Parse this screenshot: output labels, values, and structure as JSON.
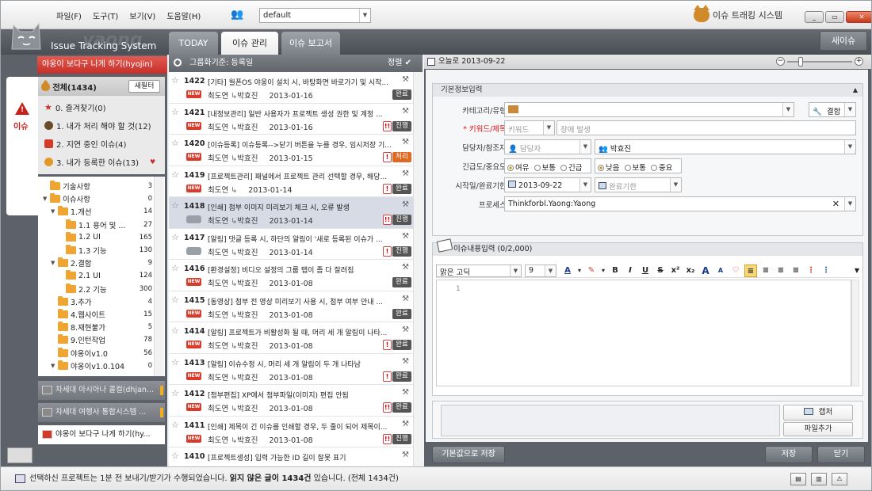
{
  "menu": [
    "파일(F)",
    "도구(T)",
    "보기(V)",
    "도움말(H)"
  ],
  "profile": {
    "value": "default"
  },
  "brand": "이슈 트래킹 시스템",
  "window_buttons": [
    "_",
    "▭",
    "✕"
  ],
  "logo": {
    "text": "Issue Tracking System",
    "watermark": "yaong"
  },
  "tabs": [
    "TODAY",
    "이슈 관리",
    "이슈 보고서"
  ],
  "new_issue": "새이슈",
  "left": {
    "project_header": "야옹이 보다구 나게 하기(hyojin)",
    "side_tab": "이슈",
    "all": "전체(1434)",
    "new_filter": "새필터",
    "filters": [
      "0. 즐겨찾기(0)",
      "1. 내가 처리 해야 할 것(12)",
      "2. 지연 중인 이슈(4)",
      "3. 내가 등록한 이슈(13)"
    ],
    "tree": [
      {
        "label": "기술사항",
        "count": "3",
        "level": 0,
        "toggle": ""
      },
      {
        "label": "이슈사항",
        "count": "0",
        "level": 0,
        "toggle": "▼"
      },
      {
        "label": "1.개선",
        "count": "14",
        "level": 1,
        "toggle": "▼"
      },
      {
        "label": "1.1 용어 및 ...",
        "count": "27",
        "level": 2,
        "toggle": ""
      },
      {
        "label": "1.2 UI",
        "count": "165",
        "level": 2,
        "toggle": ""
      },
      {
        "label": "1.3 기능",
        "count": "130",
        "level": 2,
        "toggle": ""
      },
      {
        "label": "2.결함",
        "count": "9",
        "level": 1,
        "toggle": "▼"
      },
      {
        "label": "2.1 UI",
        "count": "124",
        "level": 2,
        "toggle": ""
      },
      {
        "label": "2.2 기능",
        "count": "300",
        "level": 2,
        "toggle": ""
      },
      {
        "label": "3.추가",
        "count": "4",
        "level": 1,
        "toggle": ""
      },
      {
        "label": "4.웹사이트",
        "count": "15",
        "level": 1,
        "toggle": ""
      },
      {
        "label": "8.재현불가",
        "count": "5",
        "level": 1,
        "toggle": ""
      },
      {
        "label": "9.인턴작업",
        "count": "78",
        "level": 1,
        "toggle": ""
      },
      {
        "label": "야옹이v1.0",
        "count": "56",
        "level": 1,
        "toggle": ""
      },
      {
        "label": "야옹이v1.0.104",
        "count": "0",
        "level": 1,
        "toggle": "▼"
      }
    ],
    "projects": [
      "차세대 아시아나 콜컬(dhjan...",
      "차세대 여행사 통합시스템 ...",
      "야옹이 보다구 나게 하기(hy..."
    ]
  },
  "middle": {
    "group_by": "그룹화기준: 등록일",
    "sort": "정렬 ✔",
    "issues": [
      {
        "num": "1422",
        "title": "[기타] 월폰OS 야옹이 설치 시, 바탕화면 바로가기 및 시작...",
        "author": "최도연",
        "assignee": "박효진",
        "date": "2013-01-16",
        "status": "완료",
        "pri": "",
        "icon": "NEW"
      },
      {
        "num": "1421",
        "title": "[내정보관리] 일반 사용자가 프로젝트 생성 권한 및 계정 ...",
        "author": "최도연",
        "assignee": "박효진",
        "date": "2013-01-16",
        "status": "진행",
        "pri": "!!",
        "icon": "NEW"
      },
      {
        "num": "1420",
        "title": "[이슈등록] 이슈등록-->닫기 버튼을 누를 경우, 임시저장 기...",
        "author": "최도연",
        "assignee": "박효진",
        "date": "2013-01-15",
        "status": "처리",
        "pri": "!",
        "icon": "NEW"
      },
      {
        "num": "1419",
        "title": "[프로젝트관리] 패널에서 프로젝트 관리 선택할 경우, 해당...",
        "author": "최도연",
        "assignee": "",
        "date": "2013-01-14",
        "status": "완료",
        "pri": "!",
        "icon": "NEW"
      },
      {
        "num": "1418",
        "title": "[인쇄] 첨부 이미지 미리보기 체크 시, 오류 발생",
        "author": "최도연",
        "assignee": "박효진",
        "date": "2013-01-14",
        "status": "진행",
        "pri": "!!",
        "icon": "bubble"
      },
      {
        "num": "1417",
        "title": "[알림] 댓글 등록 시, 하단의 알림이 '새로 등록된 이슈가 ...",
        "author": "최도연",
        "assignee": "박효진",
        "date": "2013-01-14",
        "status": "진행",
        "pri": "!",
        "icon": "bubble"
      },
      {
        "num": "1416",
        "title": "[환경설정] 비디오 설정의 그룹 탭이 좀 다 잘려짐",
        "author": "최도연",
        "assignee": "박효진",
        "date": "2013-01-08",
        "status": "완료",
        "pri": "",
        "icon": "NEW"
      },
      {
        "num": "1415",
        "title": "[동영상] 첨부 전 영상 미리보기 사용 시, 첨부 여부 안내 ...",
        "author": "최도연",
        "assignee": "박효진",
        "date": "2013-01-08",
        "status": "완료",
        "pri": "",
        "icon": "NEW"
      },
      {
        "num": "1414",
        "title": "[알림] 프로젝트가 비활성화 될 때, 머리 세 개 알림이 나타...",
        "author": "최도연",
        "assignee": "박효진",
        "date": "2013-01-08",
        "status": "완료",
        "pri": "!",
        "icon": "NEW"
      },
      {
        "num": "1413",
        "title": "[알림] 이슈수정 시, 머리 세 개 알림이 두 개 나타남",
        "author": "최도연",
        "assignee": "박효진",
        "date": "2013-01-08",
        "status": "완료",
        "pri": "!",
        "icon": "NEW"
      },
      {
        "num": "1412",
        "title": "[첨부편집] XP에서 첨부파일(이미지) 편집 안됨",
        "author": "최도연",
        "assignee": "박효진",
        "date": "2013-01-08",
        "status": "완료",
        "pri": "!!",
        "icon": "NEW"
      },
      {
        "num": "1411",
        "title": "[인쇄] 제목이 긴 이슈를 인쇄할 경우, 두 줄이 되어 제목이...",
        "author": "최도연",
        "assignee": "박효진",
        "date": "2013-01-08",
        "status": "진행",
        "pri": "!!",
        "icon": "NEW"
      },
      {
        "num": "1410",
        "title": "[프로젝트생성] 입력 가능한 ID 길이 잘못 표기",
        "author": "",
        "assignee": "",
        "date": "",
        "status": "",
        "pri": "",
        "icon": ""
      }
    ]
  },
  "right": {
    "today": "오늘로 2013-09-22",
    "basic_title": "기본정보입력",
    "labels": {
      "category": "카테고리/유형:",
      "keyword": "키워드/제목:",
      "assignee": "담당자/참조자:",
      "urgency": "긴급도/중요도:",
      "dates": "시작일/완료기한:",
      "process": "프로세스:"
    },
    "category_type": "결함",
    "keyword_placeholder": "키워드",
    "title_value": "장애 발생",
    "assignee_placeholder": "담당자",
    "reference": "박효진",
    "urgency": [
      "여유",
      "보통",
      "긴급"
    ],
    "importance": [
      "낮음",
      "보통",
      "중요"
    ],
    "start_date": "2013-09-22",
    "due_placeholder": "완료기한",
    "process_value": "Thinkforbl.Yaong:Yaong",
    "content_title": "이슈내용입력 (0/2,000)",
    "font": "맑은 고딕",
    "font_size": "9",
    "toolbar": [
      "A",
      "▾",
      "✎",
      "▾",
      "B",
      "I",
      "U",
      "S",
      "x²",
      "x₂",
      "A",
      "A",
      "♡",
      "≡",
      "≡",
      "≡",
      "≡",
      "⋮",
      "⋮"
    ],
    "line_no": "1",
    "capture": "캡처",
    "add_file": "파일추가",
    "default_save": "기본값으로 저장",
    "save": "저장",
    "close": "닫기"
  },
  "status": {
    "pre": "선택하신 프로젝트는 1분 전 보내기/받기가 수행되었습니다.",
    "bold": "읽지 않은 글이 1434건",
    "post": "있습니다. (전체 1434건)"
  }
}
